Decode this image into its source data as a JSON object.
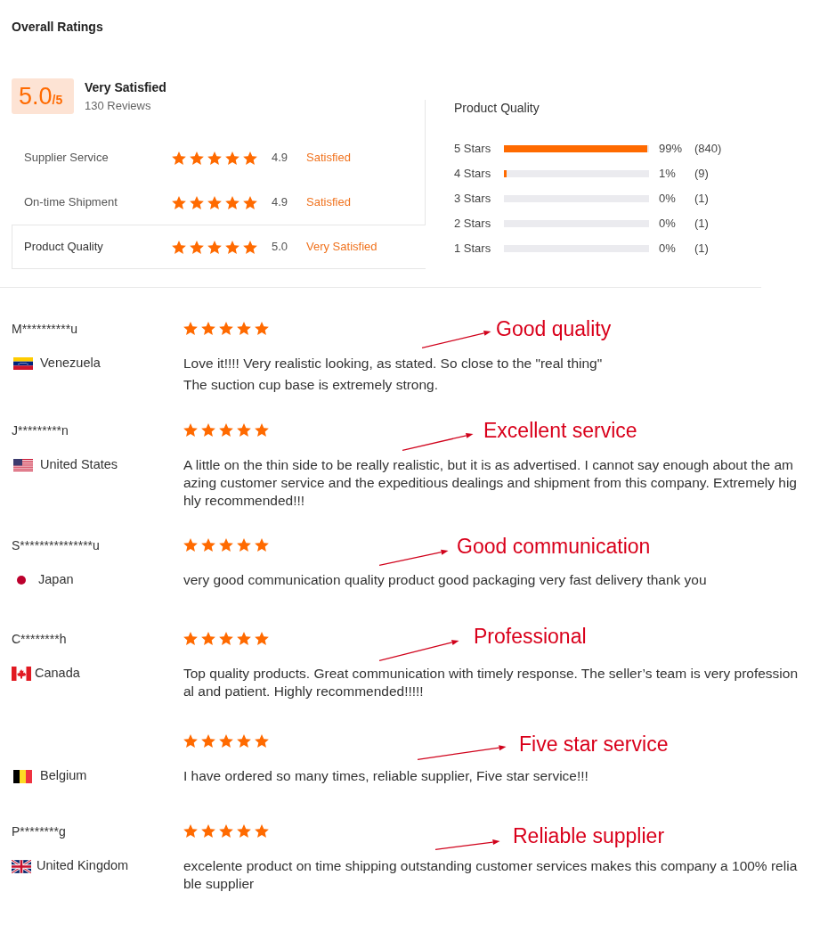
{
  "title": "Overall Ratings",
  "summary": {
    "score": "5.0",
    "scale": "/5",
    "verdict": "Very Satisfied",
    "reviews": "130 Reviews"
  },
  "ratings": [
    {
      "label": "Supplier Service",
      "stars": 5,
      "score": "4.9",
      "verdict": "Satisfied",
      "selected": false
    },
    {
      "label": "On-time Shipment",
      "stars": 5,
      "score": "4.9",
      "verdict": "Satisfied",
      "selected": false
    },
    {
      "label": "Product Quality",
      "stars": 5,
      "score": "5.0",
      "verdict": "Very Satisfied",
      "selected": true
    }
  ],
  "breakdown": {
    "title": "Product Quality",
    "rows": [
      {
        "label": "5 Stars",
        "level": 0.99,
        "percent": "99%",
        "count": "(840)"
      },
      {
        "label": "4 Stars",
        "level": 0.01,
        "percent": "1%",
        "count": "(9)"
      },
      {
        "label": "3 Stars",
        "percent": "0%",
        "count": "(1)"
      },
      {
        "label": "2 Stars",
        "percent": "0%",
        "count": "(1)"
      },
      {
        "label": "1 Stars",
        "percent": "0%",
        "count": "(1)"
      }
    ]
  },
  "reviews": [
    {
      "name": "M**********u",
      "country": "Venezuela",
      "flag": {
        "kind": "venezuela"
      },
      "stars": 5,
      "callout": "Good quality",
      "paragraphs": [
        "Love it!!!! Very realistic looking, as stated. So close to the \"real thing\"",
        "The suction cup base is extremely strong."
      ]
    },
    {
      "name": "J*********n",
      "country": "United States",
      "flag": {
        "kind": "usa"
      },
      "stars": 5,
      "callout": "Excellent service",
      "paragraphs": [
        "A little on the thin side to be really realistic, but it is as advertised. I cannot say enough about the amazing customer service and the expeditious dealings and shipment from this company. Extremely highly recommended!!!"
      ]
    },
    {
      "name": "S***************u",
      "country": "Japan",
      "flag": {
        "kind": "japan"
      },
      "stars": 5,
      "callout": "Good communication",
      "paragraphs": [
        "very good communication quality product good packaging very fast delivery thank you"
      ]
    },
    {
      "name": "C********h",
      "country": "Canada",
      "flag": {
        "kind": "canada"
      },
      "stars": 5,
      "callout": "Professional",
      "paragraphs": [
        "Top quality products. Great communication with timely response. The seller’s team is very professional and patient. Highly recommended!!!!!"
      ]
    },
    {
      "country": "Belgium",
      "flag": {
        "kind": "belgium"
      },
      "stars": 5,
      "callout": "Five star service",
      "paragraphs": [
        "I have ordered so many times, reliable supplier, Five star service!!!"
      ]
    },
    {
      "name": "P********g",
      "country": "United Kingdom",
      "flag": {
        "kind": "uk"
      },
      "stars": 5,
      "callout": "Reliable supplier",
      "paragraphs": [
        "excelente product on time shipping outstanding customer services makes this company a 100% reliable supplier"
      ]
    }
  ]
}
